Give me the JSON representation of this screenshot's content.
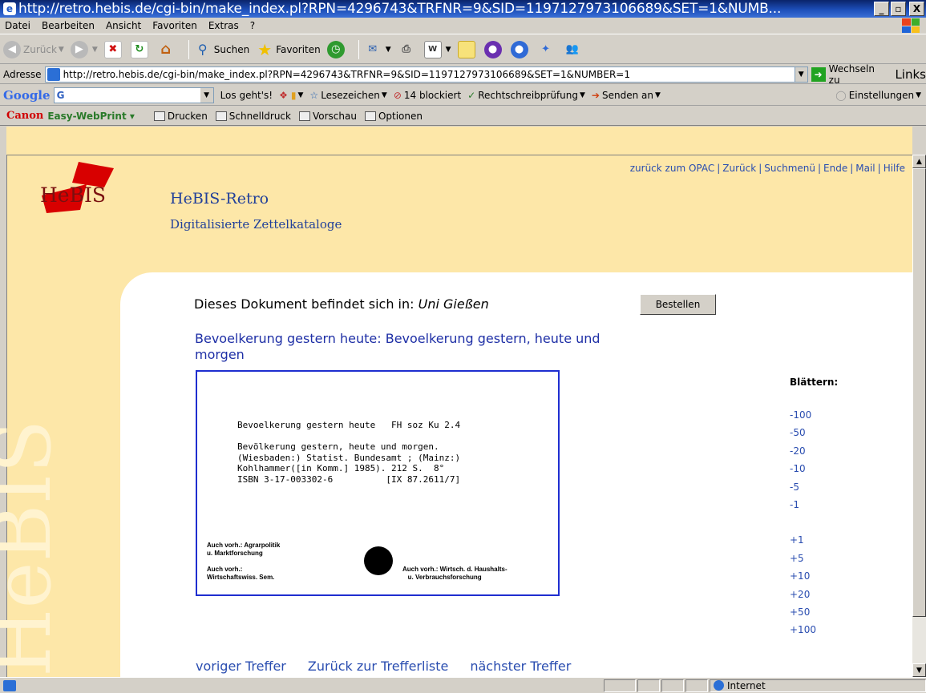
{
  "window": {
    "title": "http://retro.hebis.de/cgi-bin/make_index.pl?RPN=4296743&TRFNR=9&SID=1197127973106689&SET=1&NUMB...",
    "controls": [
      "_",
      "▫",
      "X"
    ]
  },
  "menu": [
    "Datei",
    "Bearbeiten",
    "Ansicht",
    "Favoriten",
    "Extras",
    "?"
  ],
  "toolbar": {
    "back": "Zurück",
    "search": "Suchen",
    "favorites": "Favoriten"
  },
  "address": {
    "label": "Adresse",
    "url": "http://retro.hebis.de/cgi-bin/make_index.pl?RPN=4296743&TRFNR=9&SID=1197127973106689&SET=1&NUMBER=1",
    "go": "Wechseln zu",
    "links": "Links"
  },
  "googlebar": {
    "logo": "Google",
    "search_prefix": "G",
    "go": "Los geht's!",
    "bookmarks": "Lesezeichen",
    "blocked": "14 blockiert",
    "spellcheck": "Rechtschreibprüfung",
    "send": "Senden an",
    "settings": "Einstellungen"
  },
  "canonbar": {
    "brand": "Canon",
    "product": "Easy-WebPrint",
    "print": "Drucken",
    "quick": "Schnelldruck",
    "preview": "Vorschau",
    "options": "Optionen"
  },
  "page": {
    "logo_text": "HeBIS",
    "title": "HeBIS-Retro",
    "subtitle": "Digitalisierte Zettelkataloge",
    "toplinks": [
      "zurück zum OPAC",
      "Zurück",
      "Suchmenü",
      "Ende",
      "Mail",
      "Hilfe"
    ],
    "location_label": "Dieses Dokument befindet sich in:",
    "location_value": "Uni Gießen",
    "order_button": "Bestellen",
    "record_title_bold": "Bevoelkerung gestern heute:",
    "record_title_rest": "Bevoelkerung gestern, heute und morgen",
    "card": {
      "typed": "Bevoelkerung gestern heute   FH soz Ku 2.4\n\nBevölkerung gestern, heute und morgen.\n(Wiesbaden:) Statist. Bundesamt ; (Mainz:)\nKohlhammer([in Komm.] 1985). 212 S.  8°\nISBN 3-17-003302-6          [IX 87.2611/7]",
      "note_left_1": "Auch vorh.: Agrarpolitik\nu. Marktforschung",
      "note_left_2": "Auch vorh.:\nWirtschaftswiss. Sem.",
      "note_right": "Auch vorh.: Wirtsch. d. Haushalts-\n   u. Verbrauchsforschung"
    },
    "browse_label": "Blättern:",
    "browse_back": [
      "-100",
      "-50",
      "-20",
      "-10",
      "-5",
      "-1"
    ],
    "browse_fwd": [
      "+1",
      "+5",
      "+10",
      "+20",
      "+50",
      "+100"
    ],
    "bottom_nav": [
      "voriger Treffer",
      "Zurück zur Trefferliste",
      "nächster Treffer"
    ]
  },
  "status": {
    "zone": "Internet"
  }
}
